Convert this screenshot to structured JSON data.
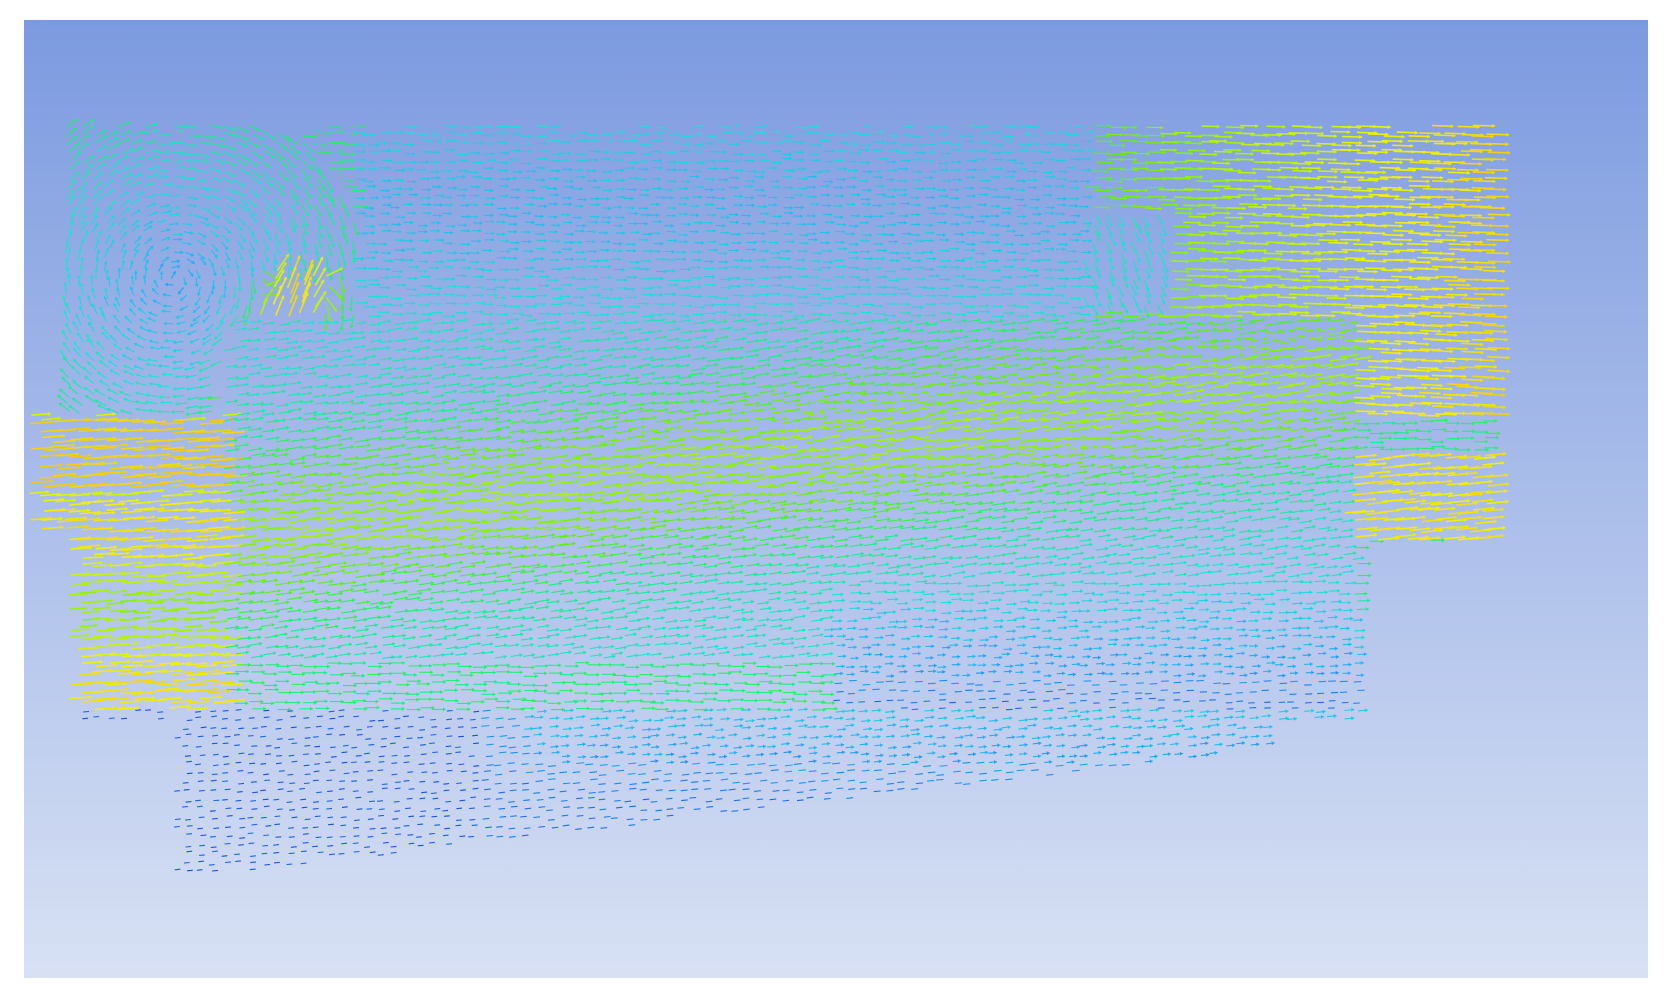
{
  "viewport": {
    "background_top": "#7c9ae0",
    "background_bottom": "#d8e1f4"
  },
  "vector_field": {
    "description_type": "velocity-vector-plot",
    "colormap": [
      "#0a2fd8",
      "#1e6ff0",
      "#22b8f0",
      "#1fe0d8",
      "#1cf07a",
      "#5cf012",
      "#b6f012",
      "#f0f010",
      "#f0c41a",
      "#f0a020"
    ],
    "slow_color": "#1540e0",
    "fast_color": "#f0b020"
  }
}
